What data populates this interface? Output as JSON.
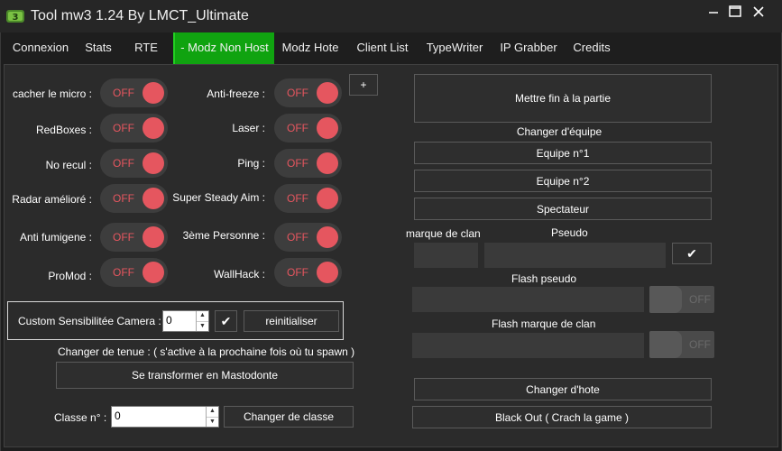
{
  "window": {
    "title": "Tool mw3 1.24 By LMCT_Ultimate"
  },
  "tabs": [
    {
      "label": "Connexion"
    },
    {
      "label": "Stats"
    },
    {
      "label": "RTE"
    },
    {
      "label": "- Modz Non Host"
    },
    {
      "label": "Modz Hote"
    },
    {
      "label": "Client List"
    },
    {
      "label": "TypeWriter"
    },
    {
      "label": "IP Grabber"
    },
    {
      "label": "Credits"
    }
  ],
  "active_tab": "- Modz Non Host",
  "toggles_left": [
    {
      "label": "cacher le micro :",
      "state": "OFF"
    },
    {
      "label": "RedBoxes :",
      "state": "OFF"
    },
    {
      "label": "No recul :",
      "state": "OFF"
    },
    {
      "label": "Radar amélioré :",
      "state": "OFF"
    },
    {
      "label": "Anti fumigene :",
      "state": "OFF"
    },
    {
      "label": "ProMod :",
      "state": "OFF"
    }
  ],
  "toggles_right": [
    {
      "label": "Anti-freeze :",
      "state": "OFF"
    },
    {
      "label": "Laser :",
      "state": "OFF"
    },
    {
      "label": "Ping :",
      "state": "OFF"
    },
    {
      "label": "Super Steady Aim :",
      "state": "OFF"
    },
    {
      "label": "3ème Personne :",
      "state": "OFF"
    },
    {
      "label": "WallHack :",
      "state": "OFF"
    }
  ],
  "plus_button": "+",
  "camera": {
    "label": "Custom Sensibilitée Camera :",
    "value": "0",
    "check": "✔",
    "reset": "reinitialiser"
  },
  "tenue": {
    "label": "Changer de tenue : ( s'active à la prochaine fois où tu spawn )",
    "button": "Se transformer en Mastodonte"
  },
  "classe": {
    "label": "Classe n° :",
    "value": "0",
    "button": "Changer de classe"
  },
  "right": {
    "end_game": "Mettre fin à la partie",
    "team_label": "Changer d'équipe",
    "team1": "Equipe n°1",
    "team2": "Equipe n°2",
    "spectator": "Spectateur",
    "clan_label": "marque de clan",
    "pseudo_label": "Pseudo",
    "clan_value": "",
    "pseudo_value": "",
    "check": "✔",
    "flash_pseudo_label": "Flash pseudo",
    "flash_pseudo_state": "OFF",
    "flash_clan_label": "Flash marque de clan",
    "flash_clan_state": "OFF",
    "change_host": "Changer d'hote",
    "black_out": "Black Out ( Crach la game )"
  },
  "colors": {
    "accent_green": "#10a310",
    "off_red": "#e5565f",
    "panel": "#2b2b2b"
  }
}
